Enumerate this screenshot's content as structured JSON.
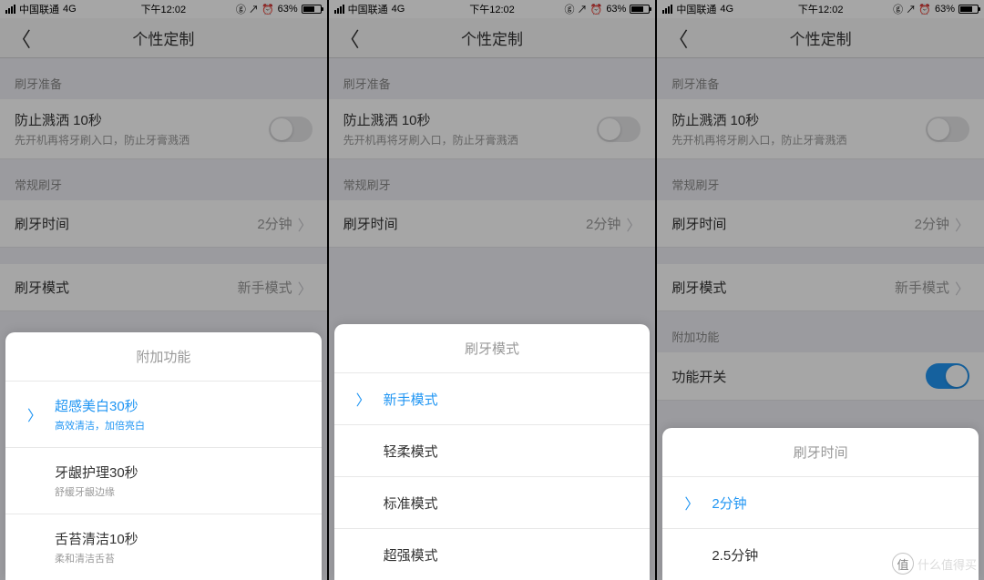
{
  "status": {
    "carrier": "中国联通",
    "network": "4G",
    "time": "下午12:02",
    "battery_pct": "63%",
    "icons": "ⓖ ↗ ⏰"
  },
  "nav": {
    "title": "个性定制"
  },
  "sections": {
    "prep": "刷牙准备",
    "regular": "常规刷牙",
    "extra": "附加功能"
  },
  "prep_row": {
    "title": "防止溅洒 10秒",
    "sub": "先开机再将牙刷入口，防止牙膏溅洒"
  },
  "time_row": {
    "label": "刷牙时间",
    "value": "2分钟"
  },
  "mode_row": {
    "label": "刷牙模式",
    "value": "新手模式"
  },
  "func_row": {
    "label": "功能开关"
  },
  "sheet_extra": {
    "title": "附加功能",
    "items": [
      {
        "title": "超感美白30秒",
        "sub": "高效清洁，加倍亮白",
        "selected": true
      },
      {
        "title": "牙龈护理30秒",
        "sub": "舒缓牙龈边缘",
        "selected": false
      },
      {
        "title": "舌苔清洁10秒",
        "sub": "柔和清洁舌苔",
        "selected": false
      }
    ]
  },
  "sheet_mode": {
    "title": "刷牙模式",
    "items": [
      {
        "title": "新手模式",
        "selected": true
      },
      {
        "title": "轻柔模式",
        "selected": false
      },
      {
        "title": "标准模式",
        "selected": false
      },
      {
        "title": "超强模式",
        "selected": false
      }
    ]
  },
  "sheet_time": {
    "title": "刷牙时间",
    "items": [
      {
        "title": "2分钟",
        "selected": true
      },
      {
        "title": "2.5分钟",
        "selected": false
      }
    ]
  },
  "watermark": {
    "char": "值",
    "text": "什么值得买"
  }
}
